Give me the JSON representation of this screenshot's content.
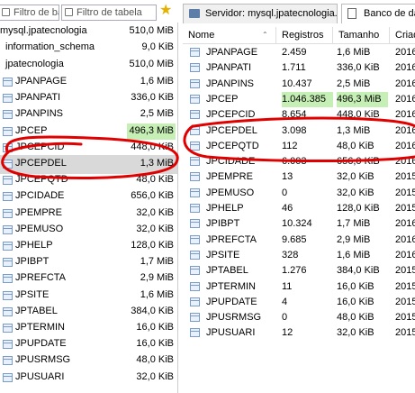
{
  "toolbar": {
    "db_filter_placeholder": "Filtro de banco de",
    "table_filter_placeholder": "Filtro de tabela"
  },
  "tabs": [
    {
      "label": "Servidor: mysql.jpatecnologia..."
    },
    {
      "label": "Banco de dados"
    }
  ],
  "tree": {
    "server": {
      "label": "mysql.jpatecnologia",
      "size": "510,0 MiB"
    },
    "databases": [
      {
        "label": "information_schema",
        "size": "9,0 KiB"
      },
      {
        "label": "jpatecnologia",
        "size": "510,0 MiB"
      }
    ],
    "tables": [
      {
        "label": "JPANPAGE",
        "size": "1,6 MiB"
      },
      {
        "label": "JPANPATI",
        "size": "336,0 KiB"
      },
      {
        "label": "JPANPINS",
        "size": "2,5 MiB"
      },
      {
        "label": "JPCEP",
        "size": "496,3 MiB"
      },
      {
        "label": "JPCEPCID",
        "size": "448,0 KiB"
      },
      {
        "label": "JPCEPDEL",
        "size": "1,3 MiB"
      },
      {
        "label": "JPCEPQTD",
        "size": "48,0 KiB"
      },
      {
        "label": "JPCIDADE",
        "size": "656,0 KiB"
      },
      {
        "label": "JPEMPRE",
        "size": "32,0 KiB"
      },
      {
        "label": "JPEMUSO",
        "size": "32,0 KiB"
      },
      {
        "label": "JPHELP",
        "size": "128,0 KiB"
      },
      {
        "label": "JPIBPT",
        "size": "1,7 MiB"
      },
      {
        "label": "JPREFCTA",
        "size": "2,9 MiB"
      },
      {
        "label": "JPSITE",
        "size": "1,6 MiB"
      },
      {
        "label": "JPTABEL",
        "size": "384,0 KiB"
      },
      {
        "label": "JPTERMIN",
        "size": "16,0 KiB"
      },
      {
        "label": "JPUPDATE",
        "size": "16,0 KiB"
      },
      {
        "label": "JPUSRMSG",
        "size": "48,0 KiB"
      },
      {
        "label": "JPUSUARI",
        "size": "32,0 KiB"
      }
    ]
  },
  "grid": {
    "columns": [
      "Nome",
      "Registros",
      "Tamanho",
      "Criad"
    ],
    "rows": [
      {
        "name": "JPANPAGE",
        "records": "2.459",
        "size": "1,6 MiB",
        "created": "2016"
      },
      {
        "name": "JPANPATI",
        "records": "1.711",
        "size": "336,0 KiB",
        "created": "2016"
      },
      {
        "name": "JPANPINS",
        "records": "10.437",
        "size": "2,5 MiB",
        "created": "2016"
      },
      {
        "name": "JPCEP",
        "records": "1.046.385",
        "size": "496,3 MiB",
        "created": "2016"
      },
      {
        "name": "JPCEPCID",
        "records": "8.654",
        "size": "448,0 KiB",
        "created": "2016"
      },
      {
        "name": "JPCEPDEL",
        "records": "3.098",
        "size": "1,3 MiB",
        "created": "2016"
      },
      {
        "name": "JPCEPQTD",
        "records": "112",
        "size": "48,0 KiB",
        "created": "2016"
      },
      {
        "name": "JPCIDADE",
        "records": "6.003",
        "size": "656,0 KiB",
        "created": "2016"
      },
      {
        "name": "JPEMPRE",
        "records": "13",
        "size": "32,0 KiB",
        "created": "2015"
      },
      {
        "name": "JPEMUSO",
        "records": "0",
        "size": "32,0 KiB",
        "created": "2015"
      },
      {
        "name": "JPHELP",
        "records": "46",
        "size": "128,0 KiB",
        "created": "2015"
      },
      {
        "name": "JPIBPT",
        "records": "10.324",
        "size": "1,7 MiB",
        "created": "2016"
      },
      {
        "name": "JPREFCTA",
        "records": "9.685",
        "size": "2,9 MiB",
        "created": "2016"
      },
      {
        "name": "JPSITE",
        "records": "328",
        "size": "1,6 MiB",
        "created": "2016"
      },
      {
        "name": "JPTABEL",
        "records": "1.276",
        "size": "384,0 KiB",
        "created": "2015"
      },
      {
        "name": "JPTERMIN",
        "records": "11",
        "size": "16,0 KiB",
        "created": "2015"
      },
      {
        "name": "JPUPDATE",
        "records": "4",
        "size": "16,0 KiB",
        "created": "2015"
      },
      {
        "name": "JPUSRMSG",
        "records": "0",
        "size": "48,0 KiB",
        "created": "2015"
      },
      {
        "name": "JPUSUARI",
        "records": "12",
        "size": "32,0 KiB",
        "created": "2015"
      }
    ]
  },
  "colors": {
    "highlight_green": "#c6efb5",
    "selection_gray": "#d9d9d9",
    "annotation_red": "#e00000"
  }
}
